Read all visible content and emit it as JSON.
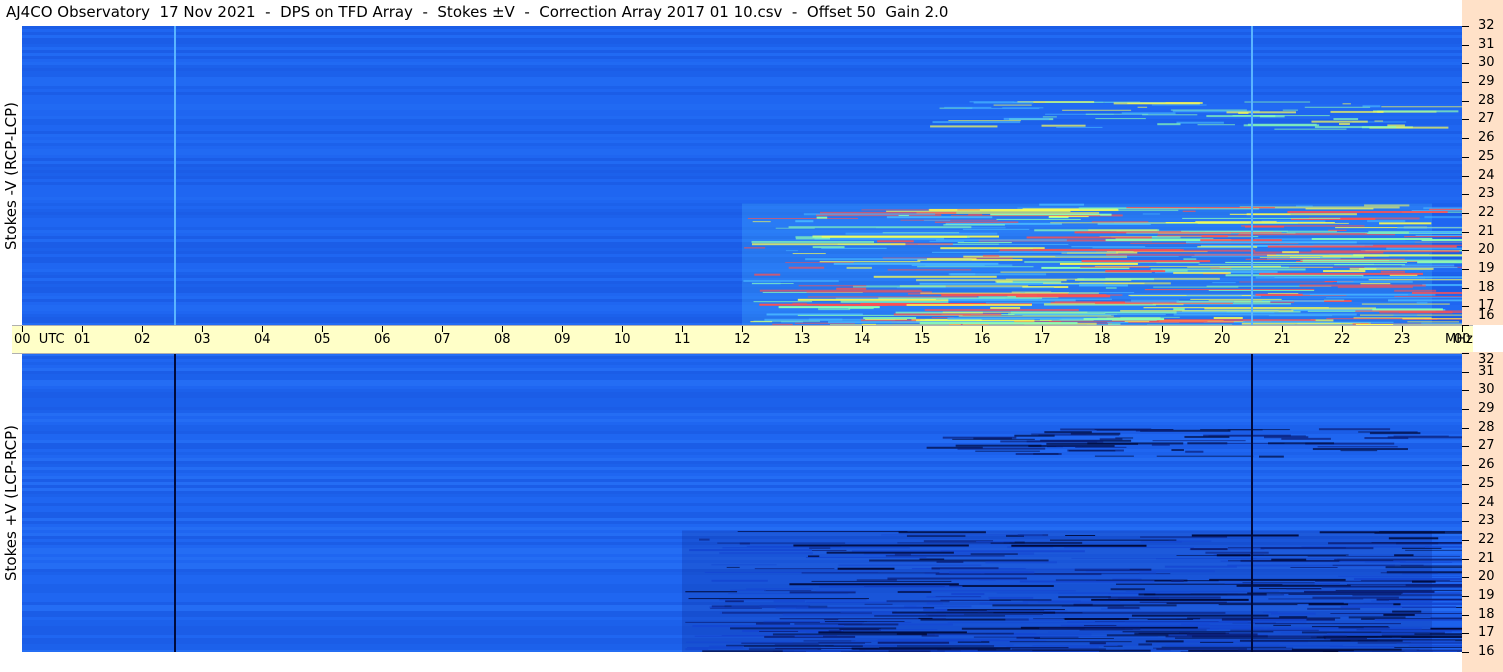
{
  "title": "AJ4CO Observatory  17 Nov 2021  -  DPS on TFD Array  -  Stokes ±V  -  Correction Array 2017 01 10.csv  -  Offset 50  Gain 2.0",
  "chart_data": [
    {
      "type": "heatmap",
      "title": "Stokes -V (RCP-LCP)",
      "ylabel": "Stokes -V (RCP-LCP)",
      "xlabel": "UTC",
      "x_range_utc_hours": [
        0,
        24
      ],
      "y_range_mhz": [
        16,
        32
      ],
      "colormap": [
        "#0a1e78",
        "#1446d2",
        "#1e64f0",
        "#46b4ff",
        "#8cffb4",
        "#ffff50",
        "#ff5050"
      ],
      "background_color": "#1e64f0",
      "bright_emission_region": {
        "utc_start": 12.0,
        "utc_end": 23.5,
        "mhz_start": 16,
        "mhz_end": 22.5
      },
      "vertical_lines_utc": [
        2.55,
        20.5
      ],
      "vertical_line_color": "light"
    },
    {
      "type": "heatmap",
      "title": "Stokes +V (LCP-RCP)",
      "ylabel": "Stokes +V (LCP-RCP)",
      "xlabel": "UTC",
      "x_range_utc_hours": [
        0,
        24
      ],
      "y_range_mhz": [
        16,
        32
      ],
      "colormap": [
        "#000a3c",
        "#0a1e78",
        "#1446d2",
        "#1e64f0",
        "#46b4ff",
        "#8cffb4"
      ],
      "background_color": "#1e64f0",
      "dark_emission_region": {
        "utc_start": 11.0,
        "utc_end": 23.5,
        "mhz_start": 16,
        "mhz_end": 22.5
      },
      "vertical_lines_utc": [
        2.55,
        20.5
      ],
      "vertical_line_color": "dark"
    }
  ],
  "time_axis": {
    "labels": [
      "00  UTC",
      "01",
      "02",
      "03",
      "04",
      "05",
      "06",
      "07",
      "08",
      "09",
      "10",
      "11",
      "12",
      "13",
      "14",
      "15",
      "16",
      "17",
      "18",
      "19",
      "20",
      "21",
      "22",
      "23",
      "00"
    ],
    "unit": "MHz"
  },
  "mhz_axis": {
    "labels": [
      "32",
      "31",
      "30",
      "29",
      "28",
      "27",
      "26",
      "25",
      "24",
      "23",
      "22",
      "21",
      "20",
      "19",
      "18",
      "17",
      "16"
    ]
  }
}
